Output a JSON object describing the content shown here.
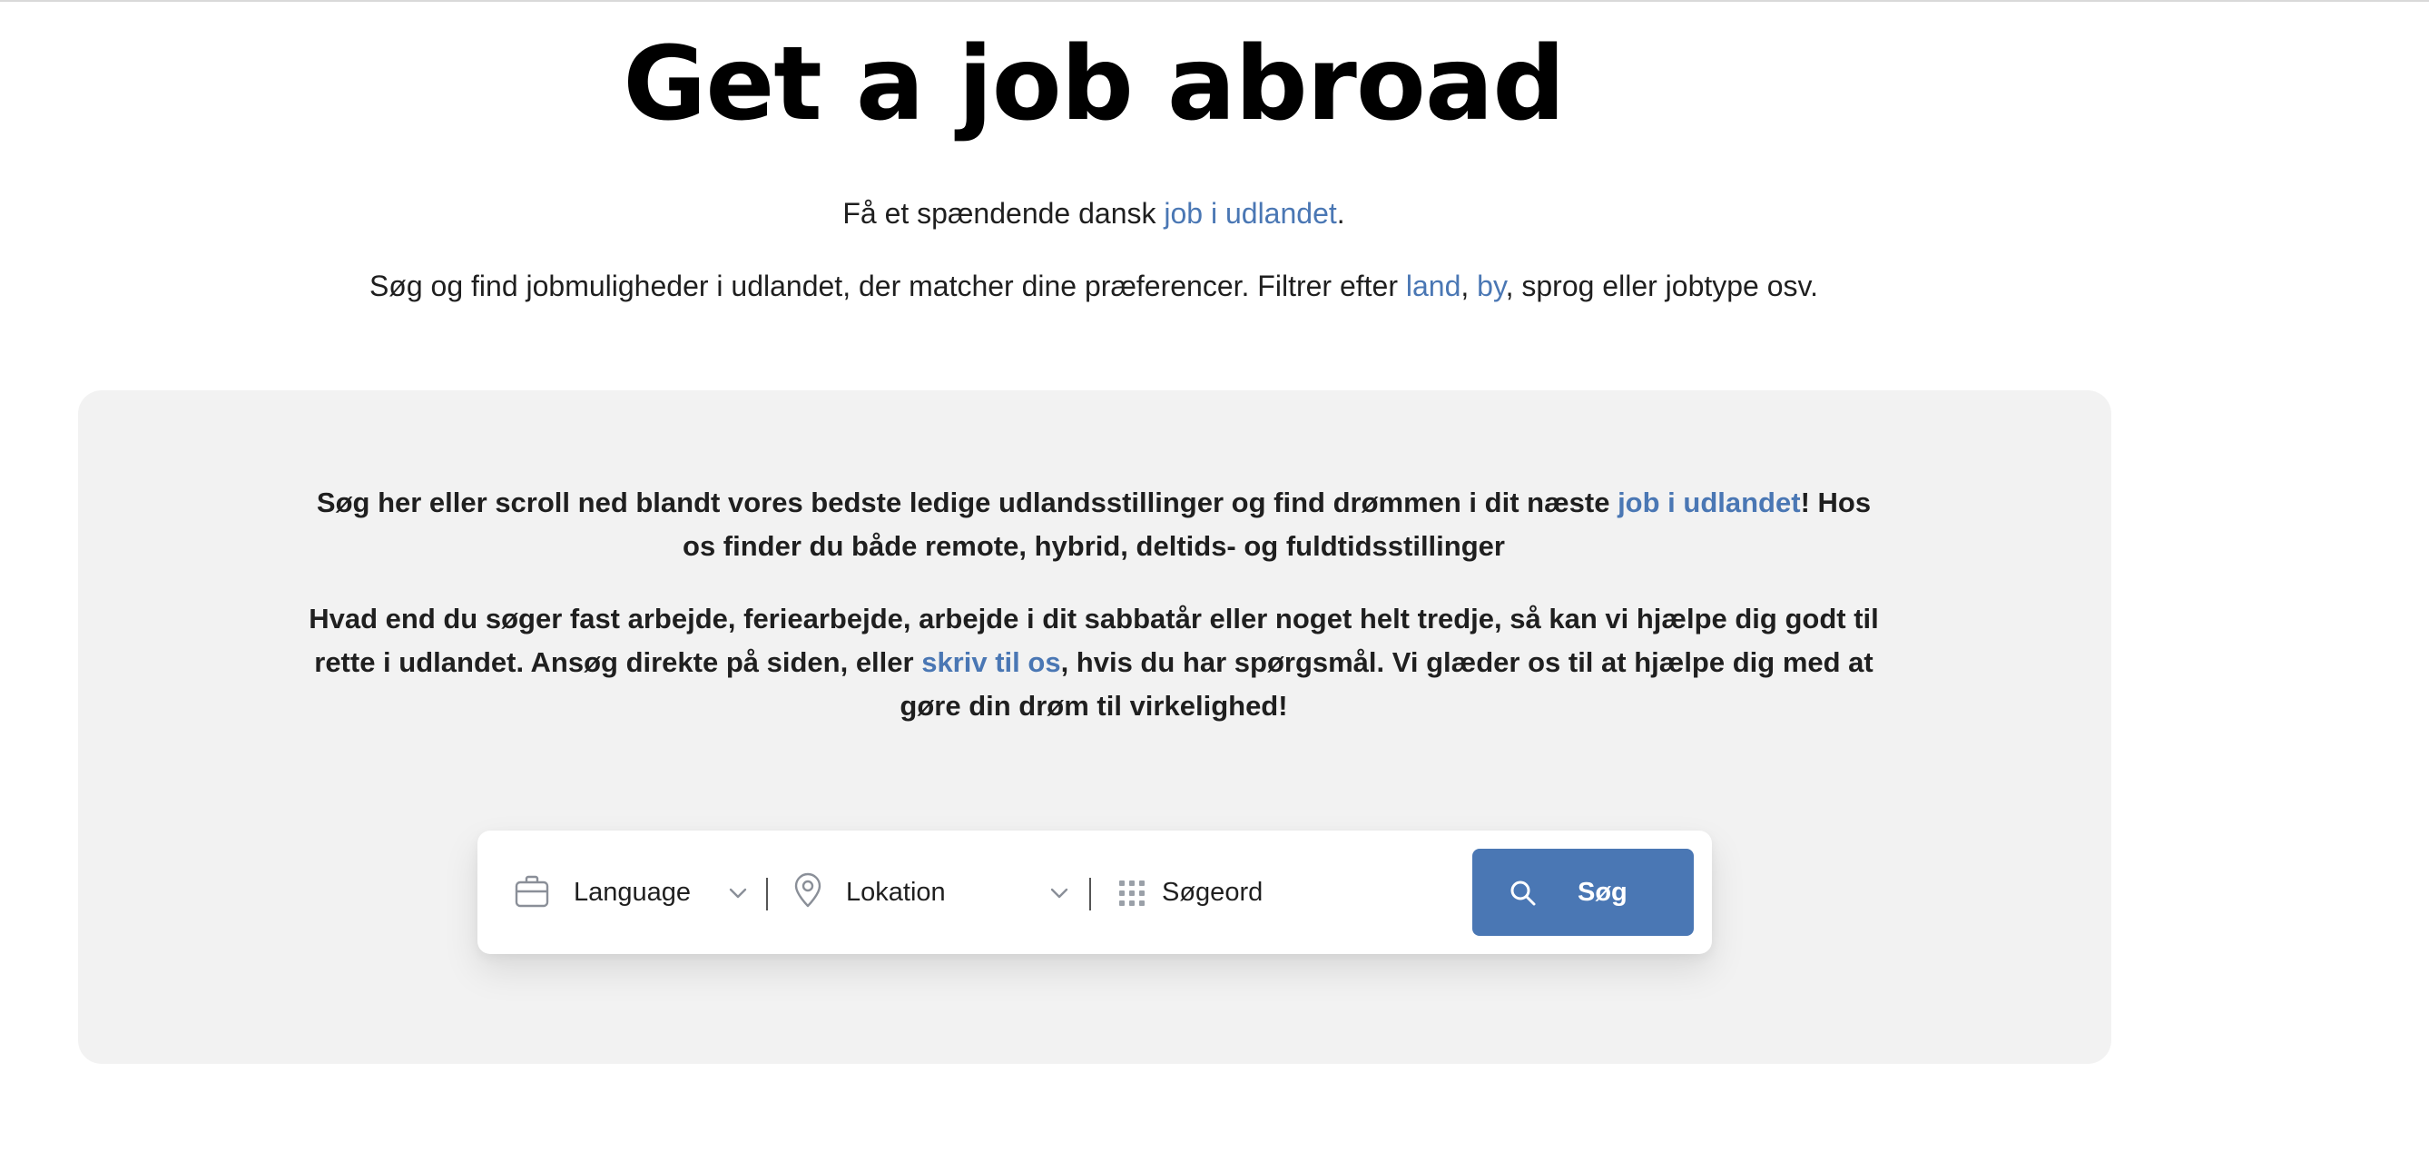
{
  "header": {
    "title": "Get a job abroad"
  },
  "intro": {
    "line1_prefix": "Få et spændende dansk ",
    "line1_link": "job i udlandet",
    "line1_suffix": ".",
    "line2_prefix": "Søg og find jobmuligheder i udlandet, der matcher dine præferencer. Filtrer efter ",
    "line2_link_country": "land",
    "line2_sep": ", ",
    "line2_link_city": "by",
    "line2_suffix": ", sprog eller jobtype osv."
  },
  "panel": {
    "p1_prefix": "Søg her eller scroll ned blandt vores bedste ledige udlandsstillinger og find drømmen i dit næste ",
    "p1_link": "job i udlandet",
    "p1_suffix": "! Hos os finder du både remote, hybrid, deltids- og fuldtidsstillinger",
    "p2_prefix": "Hvad end du søger fast arbejde, feriearbejde, arbejde i dit sabbatår eller noget helt tredje, så kan vi hjælpe dig godt til rette i udlandet. Ansøg direkte på siden, eller ",
    "p2_link": "skriv til os",
    "p2_suffix": ", hvis du har spørgsmål. Vi glæder os til at hjælpe dig med at gøre din drøm til virkelighed!"
  },
  "search": {
    "language_label": "Language",
    "location_label": "Lokation",
    "keyword_placeholder": "Søgeord",
    "button_label": "Søg"
  },
  "colors": {
    "link": "#4a77b4",
    "button": "#4a77b4",
    "panel_bg": "#f2f2f2"
  },
  "icons": {
    "language": "briefcase-icon",
    "location": "map-pin-icon",
    "keyword": "grid-dots-icon",
    "button": "search-icon",
    "dropdown": "chevron-down-icon"
  }
}
